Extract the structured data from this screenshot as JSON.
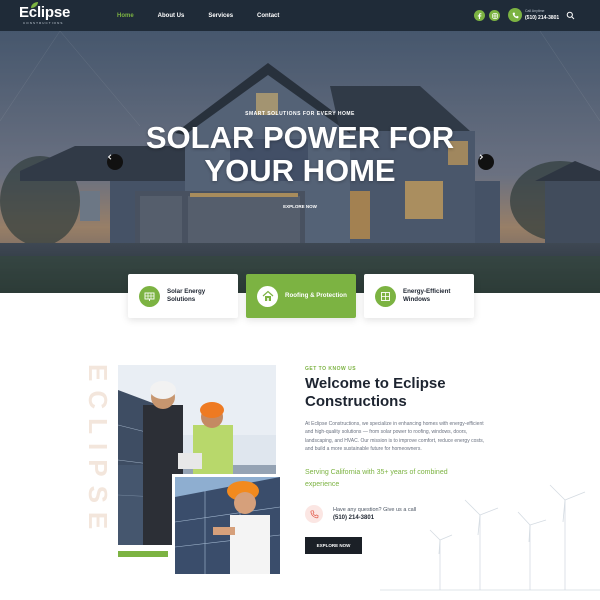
{
  "header": {
    "logo_word": "Eclipse",
    "logo_sub": "CONSTRUCTIONS",
    "nav": [
      "Home",
      "About Us",
      "Services",
      "Contact"
    ],
    "active_nav": "Home",
    "social_icons": [
      "facebook-icon",
      "instagram-icon"
    ],
    "call_label": "Call Anytime",
    "call_number": "(510) 214-3801",
    "search_icon": "search-icon"
  },
  "hero": {
    "eyebrow": "SMART SOLUTIONS FOR EVERY HOME",
    "title_line1": "SOLAR POWER FOR",
    "title_line2": "YOUR HOME",
    "cta": "EXPLORE NOW",
    "prev_icon": "chevron-left-icon",
    "next_icon": "chevron-right-icon"
  },
  "cards": [
    {
      "label": "Solar Energy Solutions",
      "icon": "solar-panel-icon",
      "active": false
    },
    {
      "label": "Roofing & Protection",
      "icon": "house-icon",
      "active": true
    },
    {
      "label": "Energy-Efficient Windows",
      "icon": "window-icon",
      "active": false
    }
  ],
  "about": {
    "vertical_word": "ECLIPSE",
    "eyebrow": "GET TO KNOW US",
    "title": "Welcome to Eclipse Constructions",
    "body": "At Eclipse Constructions, we specialize in enhancing homes with energy-efficient and high-quality solutions — from solar power to roofing, windows, doors, landscaping, and HVAC. Our mission is to improve comfort, reduce energy costs, and build a more sustainable future for homeowners.",
    "highlight": "Serving California with 35+ years of combined experience",
    "question_label": "Have any question? Give us a call",
    "question_phone": "(510) 214-3801",
    "cta": "EXPLORE NOW"
  },
  "colors": {
    "header_bg": "#1f2b38",
    "accent": "#7cb342",
    "dark_button": "#1b2027"
  }
}
